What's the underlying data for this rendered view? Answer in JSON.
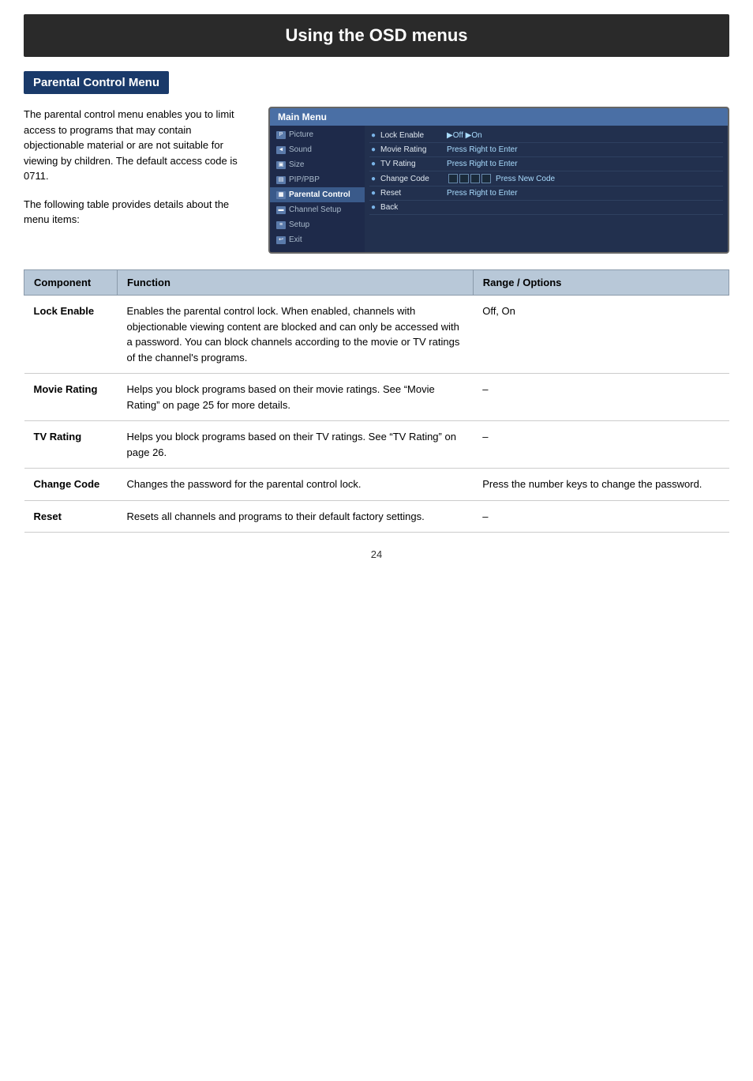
{
  "header": {
    "title": "Using the OSD menus"
  },
  "section": {
    "heading": "Parental Control Menu"
  },
  "intro_text": {
    "paragraph1": "The parental control menu enables you to limit access to programs that may contain objectionable material or are not suitable for viewing by children. The default access code is 0711.",
    "paragraph2": "The following table provides details about the menu items:"
  },
  "osd_menu": {
    "title": "Main Menu",
    "left_items": [
      {
        "label": "Picture",
        "icon": "P",
        "active": false
      },
      {
        "label": "Sound",
        "icon": "S",
        "active": false
      },
      {
        "label": "Size",
        "icon": "Z",
        "active": false
      },
      {
        "label": "PIP/PBP",
        "icon": "P",
        "active": false
      },
      {
        "label": "Parental Control",
        "icon": "C",
        "active": true
      },
      {
        "label": "Channel Setup",
        "icon": "H",
        "active": false
      },
      {
        "label": "Setup",
        "icon": "T",
        "active": false
      },
      {
        "label": "Exit",
        "icon": "X",
        "active": false
      }
    ],
    "right_options": [
      {
        "name": "Lock Enable",
        "value": "▶Off  ▶On"
      },
      {
        "name": "Movie Rating",
        "value": "Press Right to  Enter"
      },
      {
        "name": "TV Rating",
        "value": "Press Right to  Enter"
      },
      {
        "name": "Change Code",
        "value": "Press New Code",
        "has_boxes": true
      },
      {
        "name": "Reset",
        "value": "Press Right to  Enter"
      },
      {
        "name": "Back",
        "value": ""
      }
    ]
  },
  "table": {
    "columns": [
      "Component",
      "Function",
      "Range / Options"
    ],
    "rows": [
      {
        "component": "Lock Enable",
        "function": "Enables the parental control lock. When enabled, channels with objectionable viewing content are blocked and can only be accessed with a password. You can block channels according to the movie or TV ratings of the channel's programs.",
        "range": "Off, On"
      },
      {
        "component": "Movie Rating",
        "function": "Helps you block programs based on their movie ratings. See “Movie Rating” on page 25 for more details.",
        "range": "–"
      },
      {
        "component": "TV Rating",
        "function": "Helps you block programs based on their TV ratings. See “TV Rating” on page 26.",
        "range": "–"
      },
      {
        "component": "Change Code",
        "function": "Changes the password for the parental control lock.",
        "range": "Press the number keys to change the password."
      },
      {
        "component": "Reset",
        "function": "Resets all channels and programs to their default factory settings.",
        "range": "–"
      }
    ]
  },
  "page_number": "24"
}
